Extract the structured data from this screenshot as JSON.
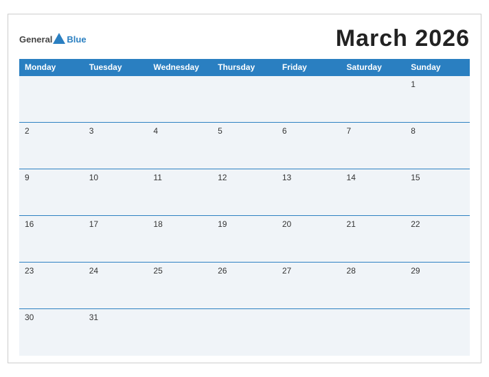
{
  "header": {
    "logo_general": "General",
    "logo_blue": "Blue",
    "month_title": "March 2026"
  },
  "weekdays": [
    "Monday",
    "Tuesday",
    "Wednesday",
    "Thursday",
    "Friday",
    "Saturday",
    "Sunday"
  ],
  "weeks": [
    [
      "",
      "",
      "",
      "",
      "",
      "",
      "1"
    ],
    [
      "2",
      "3",
      "4",
      "5",
      "6",
      "7",
      "8"
    ],
    [
      "9",
      "10",
      "11",
      "12",
      "13",
      "14",
      "15"
    ],
    [
      "16",
      "17",
      "18",
      "19",
      "20",
      "21",
      "22"
    ],
    [
      "23",
      "24",
      "25",
      "26",
      "27",
      "28",
      "29"
    ],
    [
      "30",
      "31",
      "",
      "",
      "",
      "",
      ""
    ]
  ]
}
